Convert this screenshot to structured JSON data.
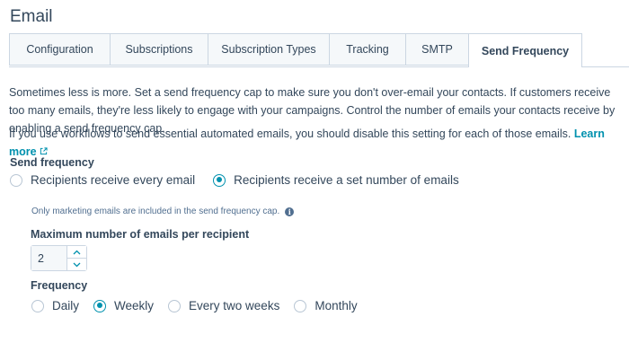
{
  "page": {
    "title": "Email"
  },
  "tabs": [
    {
      "label": "Configuration"
    },
    {
      "label": "Subscriptions"
    },
    {
      "label": "Subscription Types"
    },
    {
      "label": "Tracking"
    },
    {
      "label": "SMTP"
    },
    {
      "label": "Send Frequency",
      "active": true
    }
  ],
  "intro": "Sometimes less is more. Set a send frequency cap to make sure you don't over-email your contacts. If customers receive too many emails, they're less likely to engage with your campaigns. Control the number of emails your contacts receive by enabling a send frequency cap.",
  "workflow_note": {
    "text": "If you use workflows to send essential automated emails, you should disable this setting for each of those emails.",
    "link": "Learn more"
  },
  "send_frequency": {
    "label": "Send frequency",
    "options": [
      {
        "label": "Recipients receive every email",
        "selected": false
      },
      {
        "label": "Recipients receive a set number of emails",
        "selected": true
      }
    ],
    "hint": "Only marketing emails are included in the send frequency cap."
  },
  "max_emails": {
    "label": "Maximum number of emails per recipient",
    "value": "2"
  },
  "frequency": {
    "label": "Frequency",
    "options": [
      {
        "label": "Daily",
        "selected": false
      },
      {
        "label": "Weekly",
        "selected": true
      },
      {
        "label": "Every two weeks",
        "selected": false
      },
      {
        "label": "Monthly",
        "selected": false
      }
    ]
  },
  "colors": {
    "accent": "#0091ae",
    "text": "#33475b",
    "border": "#cbd6e2",
    "tab_bg": "#f5f8fa"
  }
}
